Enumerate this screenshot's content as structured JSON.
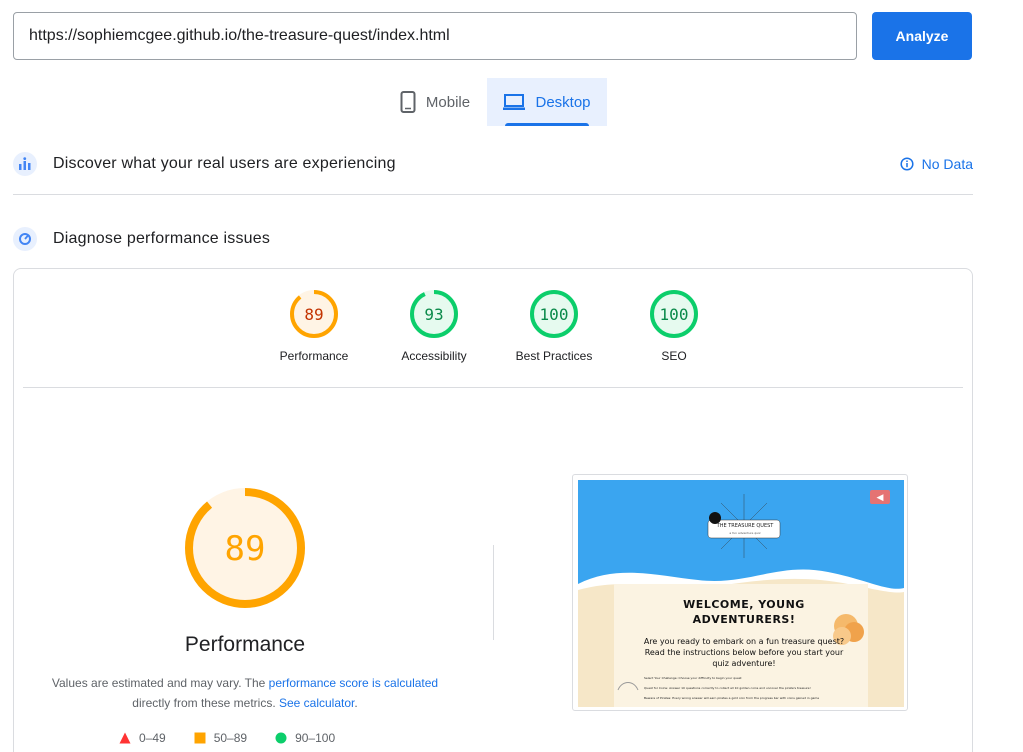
{
  "url_bar": {
    "value": "https://sophiemcgee.github.io/the-treasure-quest/index.html",
    "analyze_label": "Analyze"
  },
  "device_tabs": [
    {
      "label": "Mobile",
      "icon": "phone-icon",
      "selected": false
    },
    {
      "label": "Desktop",
      "icon": "laptop-icon",
      "selected": true
    }
  ],
  "crux_section": {
    "title": "Discover what your real users are experiencing",
    "status": "No Data",
    "icon": "users-chart-icon"
  },
  "diagnose_section": {
    "title": "Diagnose performance issues",
    "icon": "gauge-icon"
  },
  "scores": [
    {
      "label": "Performance",
      "value": "89",
      "score": 89,
      "color": "#ffa400"
    },
    {
      "label": "Accessibility",
      "value": "93",
      "score": 93,
      "color": "#0cce6b"
    },
    {
      "label": "Best Practices",
      "value": "100",
      "score": 100,
      "color": "#0cce6b"
    },
    {
      "label": "SEO",
      "value": "100",
      "score": 100,
      "color": "#0cce6b"
    }
  ],
  "performance_detail": {
    "value": "89",
    "score": 89,
    "title": "Performance",
    "note_prefix": "Values are estimated and may vary. The ",
    "note_link1": "performance score is calculated",
    "note_middle": " directly from these metrics. ",
    "note_link2": "See calculator",
    "note_suffix": "."
  },
  "legend": [
    {
      "range": "0–49",
      "shape": "triangle",
      "color": "#ff3333"
    },
    {
      "range": "50–89",
      "shape": "square",
      "color": "#ffa400"
    },
    {
      "range": "90–100",
      "shape": "circle",
      "color": "#0cce6b"
    }
  ],
  "page_preview": {
    "logo_text": "THE TREASURE QUEST",
    "logo_sub": "a fun adventure quiz",
    "heading": "WELCOME, YOUNG ADVENTURERS!",
    "body": "Are you ready to embark on a fun treasure quest? Read the instructions below before you start your quiz adventure!",
    "instructions": [
      "Select Your Challenge: Choose your difficulty to begin your quest",
      "Quest for Coins: Answer 10 questions correctly to collect all 10 golden coins and uncover the pirate's treasure!",
      "Beware of Pirates: Every wrong answer will earn pirates a gold coin from the progress bar with coins gained in game"
    ]
  },
  "colors": {
    "accent": "#1a73e8",
    "average": "#ffa400",
    "pass": "#0cce6b",
    "fail": "#ff3333"
  }
}
